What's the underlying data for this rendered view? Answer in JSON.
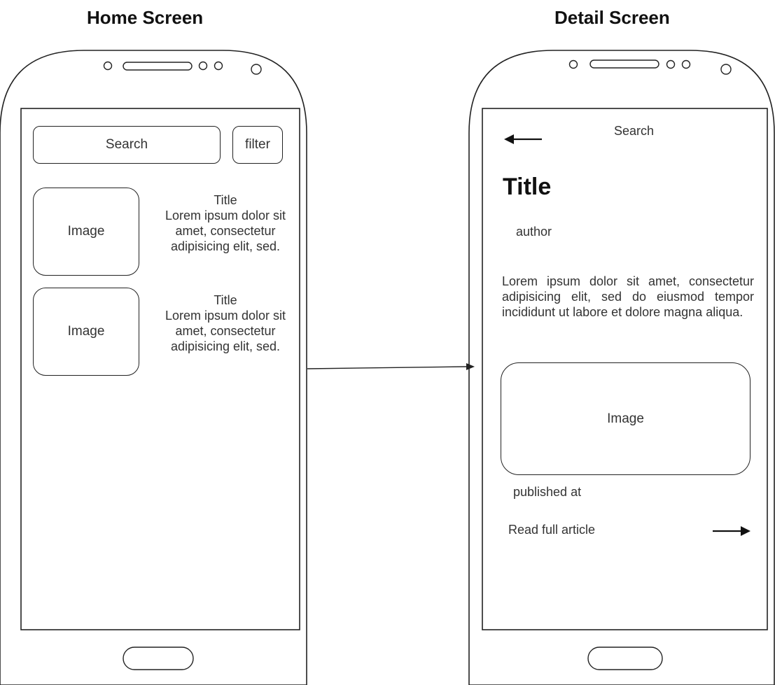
{
  "titles": {
    "home": "Home Screen",
    "detail": "Detail Screen"
  },
  "home": {
    "search": "Search",
    "filter": "filter",
    "items": [
      {
        "image": "Image",
        "title": "Title",
        "desc": "Lorem ipsum dolor sit amet, consectetur adipisicing elit, sed."
      },
      {
        "image": "Image",
        "title": "Title",
        "desc": "Lorem ipsum dolor sit amet, consectetur adipisicing elit, sed."
      }
    ]
  },
  "detail": {
    "back_icon": "arrow-left-icon",
    "search": "Search",
    "title": "Title",
    "author": "author",
    "body": "Lorem ipsum dolor sit amet, consectetur adipisicing elit, sed do eiusmod tempor incididunt ut labore et dolore magna aliqua.",
    "image": "Image",
    "published": "published at",
    "read_more": "Read full article",
    "forward_icon": "arrow-right-icon"
  },
  "connector_icon": "arrow-right-icon"
}
